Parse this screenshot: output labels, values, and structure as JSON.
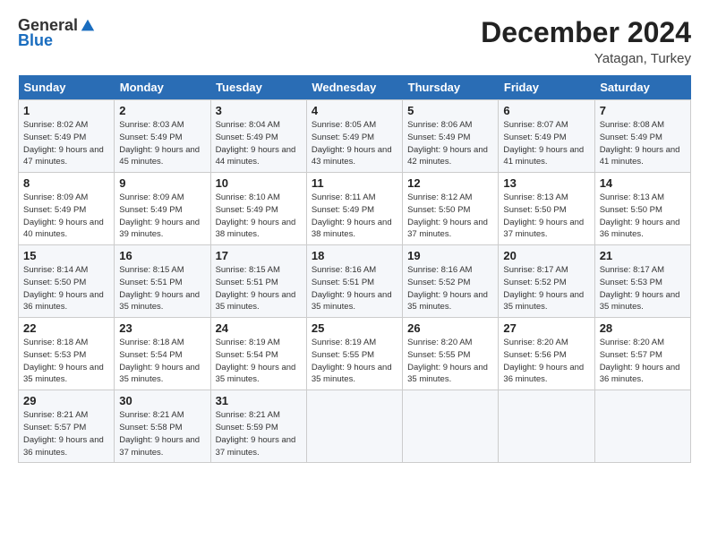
{
  "header": {
    "logo_general": "General",
    "logo_blue": "Blue",
    "month": "December 2024",
    "location": "Yatagan, Turkey"
  },
  "weekdays": [
    "Sunday",
    "Monday",
    "Tuesday",
    "Wednesday",
    "Thursday",
    "Friday",
    "Saturday"
  ],
  "weeks": [
    [
      {
        "day": "1",
        "detail": "Sunrise: 8:02 AM\nSunset: 5:49 PM\nDaylight: 9 hours\nand 47 minutes."
      },
      {
        "day": "2",
        "detail": "Sunrise: 8:03 AM\nSunset: 5:49 PM\nDaylight: 9 hours\nand 45 minutes."
      },
      {
        "day": "3",
        "detail": "Sunrise: 8:04 AM\nSunset: 5:49 PM\nDaylight: 9 hours\nand 44 minutes."
      },
      {
        "day": "4",
        "detail": "Sunrise: 8:05 AM\nSunset: 5:49 PM\nDaylight: 9 hours\nand 43 minutes."
      },
      {
        "day": "5",
        "detail": "Sunrise: 8:06 AM\nSunset: 5:49 PM\nDaylight: 9 hours\nand 42 minutes."
      },
      {
        "day": "6",
        "detail": "Sunrise: 8:07 AM\nSunset: 5:49 PM\nDaylight: 9 hours\nand 41 minutes."
      },
      {
        "day": "7",
        "detail": "Sunrise: 8:08 AM\nSunset: 5:49 PM\nDaylight: 9 hours\nand 41 minutes."
      }
    ],
    [
      {
        "day": "8",
        "detail": "Sunrise: 8:09 AM\nSunset: 5:49 PM\nDaylight: 9 hours\nand 40 minutes."
      },
      {
        "day": "9",
        "detail": "Sunrise: 8:09 AM\nSunset: 5:49 PM\nDaylight: 9 hours\nand 39 minutes."
      },
      {
        "day": "10",
        "detail": "Sunrise: 8:10 AM\nSunset: 5:49 PM\nDaylight: 9 hours\nand 38 minutes."
      },
      {
        "day": "11",
        "detail": "Sunrise: 8:11 AM\nSunset: 5:49 PM\nDaylight: 9 hours\nand 38 minutes."
      },
      {
        "day": "12",
        "detail": "Sunrise: 8:12 AM\nSunset: 5:50 PM\nDaylight: 9 hours\nand 37 minutes."
      },
      {
        "day": "13",
        "detail": "Sunrise: 8:13 AM\nSunset: 5:50 PM\nDaylight: 9 hours\nand 37 minutes."
      },
      {
        "day": "14",
        "detail": "Sunrise: 8:13 AM\nSunset: 5:50 PM\nDaylight: 9 hours\nand 36 minutes."
      }
    ],
    [
      {
        "day": "15",
        "detail": "Sunrise: 8:14 AM\nSunset: 5:50 PM\nDaylight: 9 hours\nand 36 minutes."
      },
      {
        "day": "16",
        "detail": "Sunrise: 8:15 AM\nSunset: 5:51 PM\nDaylight: 9 hours\nand 35 minutes."
      },
      {
        "day": "17",
        "detail": "Sunrise: 8:15 AM\nSunset: 5:51 PM\nDaylight: 9 hours\nand 35 minutes."
      },
      {
        "day": "18",
        "detail": "Sunrise: 8:16 AM\nSunset: 5:51 PM\nDaylight: 9 hours\nand 35 minutes."
      },
      {
        "day": "19",
        "detail": "Sunrise: 8:16 AM\nSunset: 5:52 PM\nDaylight: 9 hours\nand 35 minutes."
      },
      {
        "day": "20",
        "detail": "Sunrise: 8:17 AM\nSunset: 5:52 PM\nDaylight: 9 hours\nand 35 minutes."
      },
      {
        "day": "21",
        "detail": "Sunrise: 8:17 AM\nSunset: 5:53 PM\nDaylight: 9 hours\nand 35 minutes."
      }
    ],
    [
      {
        "day": "22",
        "detail": "Sunrise: 8:18 AM\nSunset: 5:53 PM\nDaylight: 9 hours\nand 35 minutes."
      },
      {
        "day": "23",
        "detail": "Sunrise: 8:18 AM\nSunset: 5:54 PM\nDaylight: 9 hours\nand 35 minutes."
      },
      {
        "day": "24",
        "detail": "Sunrise: 8:19 AM\nSunset: 5:54 PM\nDaylight: 9 hours\nand 35 minutes."
      },
      {
        "day": "25",
        "detail": "Sunrise: 8:19 AM\nSunset: 5:55 PM\nDaylight: 9 hours\nand 35 minutes."
      },
      {
        "day": "26",
        "detail": "Sunrise: 8:20 AM\nSunset: 5:55 PM\nDaylight: 9 hours\nand 35 minutes."
      },
      {
        "day": "27",
        "detail": "Sunrise: 8:20 AM\nSunset: 5:56 PM\nDaylight: 9 hours\nand 36 minutes."
      },
      {
        "day": "28",
        "detail": "Sunrise: 8:20 AM\nSunset: 5:57 PM\nDaylight: 9 hours\nand 36 minutes."
      }
    ],
    [
      {
        "day": "29",
        "detail": "Sunrise: 8:21 AM\nSunset: 5:57 PM\nDaylight: 9 hours\nand 36 minutes."
      },
      {
        "day": "30",
        "detail": "Sunrise: 8:21 AM\nSunset: 5:58 PM\nDaylight: 9 hours\nand 37 minutes."
      },
      {
        "day": "31",
        "detail": "Sunrise: 8:21 AM\nSunset: 5:59 PM\nDaylight: 9 hours\nand 37 minutes."
      },
      null,
      null,
      null,
      null
    ]
  ]
}
